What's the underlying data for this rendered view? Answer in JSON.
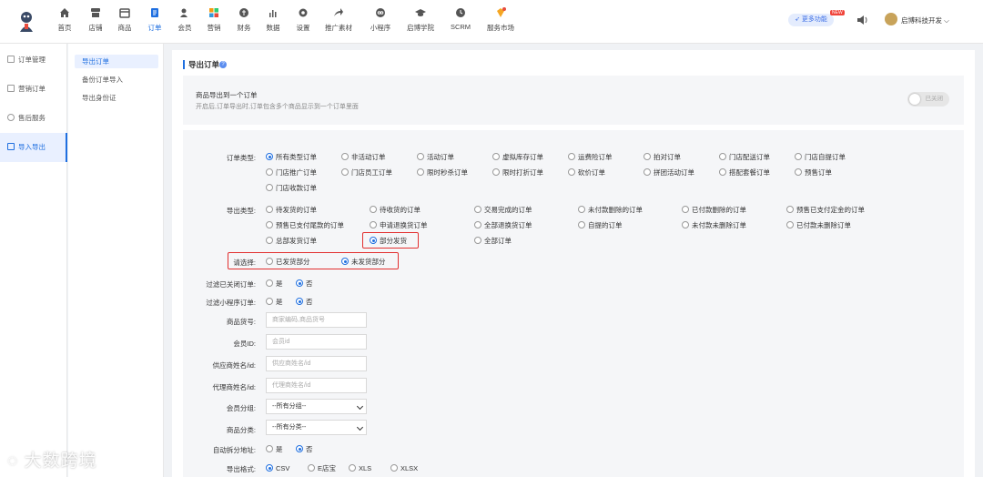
{
  "nav": [
    {
      "label": "首页",
      "icon": "home-icon"
    },
    {
      "label": "店铺",
      "icon": "shop-icon"
    },
    {
      "label": "商品",
      "icon": "goods-icon"
    },
    {
      "label": "订单",
      "icon": "order-icon"
    },
    {
      "label": "会员",
      "icon": "member-icon"
    },
    {
      "label": "营销",
      "icon": "marketing-icon"
    },
    {
      "label": "财务",
      "icon": "finance-icon"
    },
    {
      "label": "数据",
      "icon": "data-icon"
    },
    {
      "label": "设置",
      "icon": "settings-icon"
    },
    {
      "label": "推广素材",
      "icon": "promo-icon"
    },
    {
      "label": "小程序",
      "icon": "miniprogram-icon"
    },
    {
      "label": "启博学院",
      "icon": "academy-icon"
    },
    {
      "label": "SCRM",
      "icon": "scrm-icon"
    },
    {
      "label": "服务市场",
      "icon": "service-market-icon"
    }
  ],
  "active_nav": "订单",
  "topright": {
    "more_label": "更多功能",
    "new_badge": "NEW",
    "user_name": "启博科技开发"
  },
  "sidebar": [
    {
      "label": "订单管理"
    },
    {
      "label": "营销订单"
    },
    {
      "label": "售后服务"
    },
    {
      "label": "导入导出"
    }
  ],
  "subnav": [
    {
      "label": "导出订单"
    },
    {
      "label": "备份订单导入"
    },
    {
      "label": "导出身份证"
    }
  ],
  "main": {
    "title": "导出订单",
    "merge_title": "商品导出到一个订单",
    "merge_desc": "开启后,订单导出时,订单包含多个商品显示到一个订单里面",
    "toggle_label": "已关闭"
  },
  "form": {
    "order_type_label": "订单类型:",
    "order_types": [
      "所有类型订单",
      "非活动订单",
      "活动订单",
      "虚拟库存订单",
      "运费险订单",
      "拍对订单",
      "门店配送订单",
      "门店自提订单",
      "门店推广订单",
      "门店员工订单",
      "限时秒杀订单",
      "限时打折订单",
      "砍价订单",
      "拼团活动订单",
      "搭配套餐订单",
      "预售订单",
      "门店收款订单"
    ],
    "export_type_label": "导出类型:",
    "export_types": [
      "待发货的订单",
      "待收货的订单",
      "交易完成的订单",
      "未付款删除的订单",
      "已付款删除的订单",
      "预售已支付定金的订单",
      "预售已支付尾款的订单",
      "申请退换货订单",
      "全部退换货订单",
      "自提的订单",
      "未付款未删除订单",
      "已付款未删除订单",
      "总部发货订单",
      "部分发货",
      "全部订单"
    ],
    "choose_label": "请选择:",
    "choose_options": [
      "已发货部分",
      "未发货部分"
    ],
    "filter_closed_label": "过滤已关闭订单:",
    "filter_mini_label": "过滤小程序订单:",
    "yes": "是",
    "no": "否",
    "goods_no_label": "商品货号:",
    "goods_no_placeholder": "商家编码,商品货号",
    "member_id_label": "会员ID:",
    "member_id_placeholder": "会员id",
    "supplier_label": "供应商姓名/id:",
    "supplier_placeholder": "供应商姓名/id",
    "agent_label": "代理商姓名/id:",
    "agent_placeholder": "代理商姓名/id",
    "member_group_label": "会员分组:",
    "member_group_value": "--所有分组--",
    "goods_cat_label": "商品分类:",
    "goods_cat_value": "--所有分类--",
    "split_addr_label": "自动拆分地址:",
    "export_format_label": "导出格式:",
    "export_formats": [
      "CSV",
      "E店宝",
      "XLS",
      "XLSX"
    ]
  },
  "watermark": "大数跨境",
  "colors": {
    "accent": "#1f6fe0",
    "highlight": "#e22f2f"
  }
}
